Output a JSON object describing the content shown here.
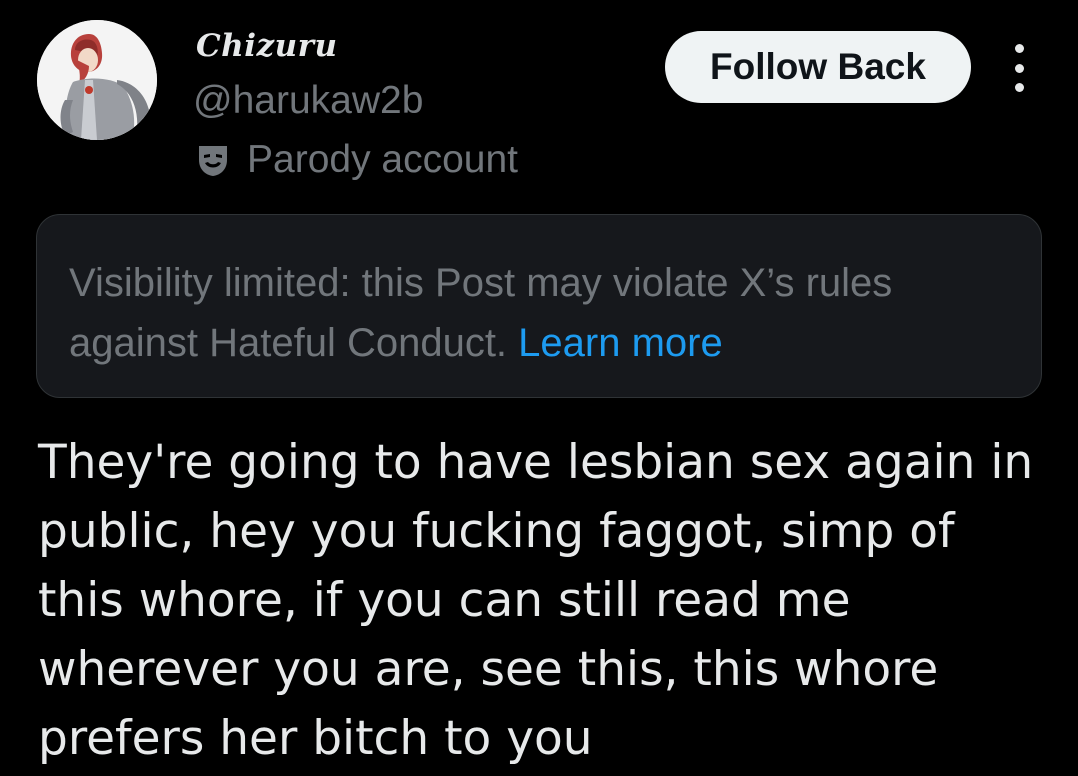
{
  "author": {
    "display_name": "Chizuru",
    "handle": "@harukaw2b",
    "label_icon": "theater-mask-icon",
    "label_text": "Parody account"
  },
  "actions": {
    "follow_label": "Follow Back",
    "more_icon": "more-vertical-icon"
  },
  "notice": {
    "text": "Visibility limited: this Post may violate X’s rules against Hateful Conduct. ",
    "link": "Learn more"
  },
  "post": {
    "text": "They're going to have lesbian sex again in public, hey you fucking faggot, simp of this whore, if you can still read me wherever you are, see this, this whore prefers her bitch to you"
  },
  "colors": {
    "background": "#000000",
    "primary_text": "#e7e9ea",
    "secondary_text": "#71767b",
    "link": "#1d9bf0",
    "button_bg": "#eff3f4",
    "notice_bg": "#16181c"
  }
}
